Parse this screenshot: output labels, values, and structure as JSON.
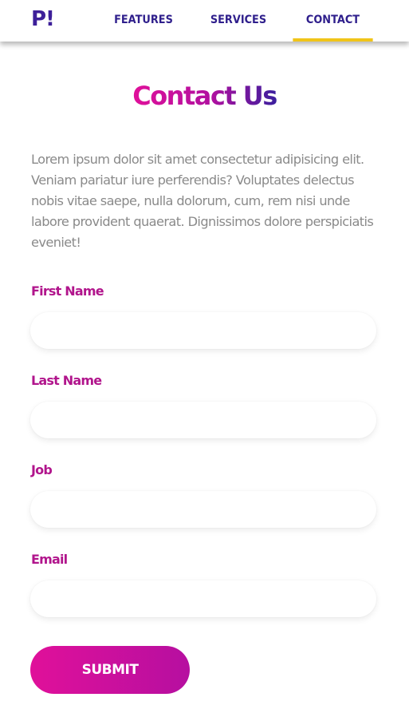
{
  "header": {
    "logo_text": "P!",
    "nav": [
      {
        "label": "FEATURES"
      },
      {
        "label": "SERVICES"
      },
      {
        "label": "CONTACT",
        "active": true
      }
    ],
    "active_indicator_color": "#f0c419"
  },
  "main": {
    "title": "Contact Us",
    "intro": "Lorem ipsum dolor sit amet consectetur adipisicing elit. Veniam pariatur iure perferendis? Voluptates delectus nobis vitae saepe, nulla dolorum, cum, rem nisi unde labore provident quaerat. Dignissimos dolore perspiciatis eveniet!",
    "form": {
      "fields": [
        {
          "label": "First Name",
          "value": "",
          "placeholder": ""
        },
        {
          "label": "Last Name",
          "value": "",
          "placeholder": ""
        },
        {
          "label": "Job",
          "value": "",
          "placeholder": ""
        },
        {
          "label": "Email",
          "value": "",
          "placeholder": ""
        }
      ],
      "submit_label": "SUBMIT"
    }
  },
  "colors": {
    "brand_purple": "#2f1f8c",
    "brand_magenta": "#e0109a",
    "label_magenta": "#b1158c",
    "text_gray": "#8a8a8a"
  }
}
